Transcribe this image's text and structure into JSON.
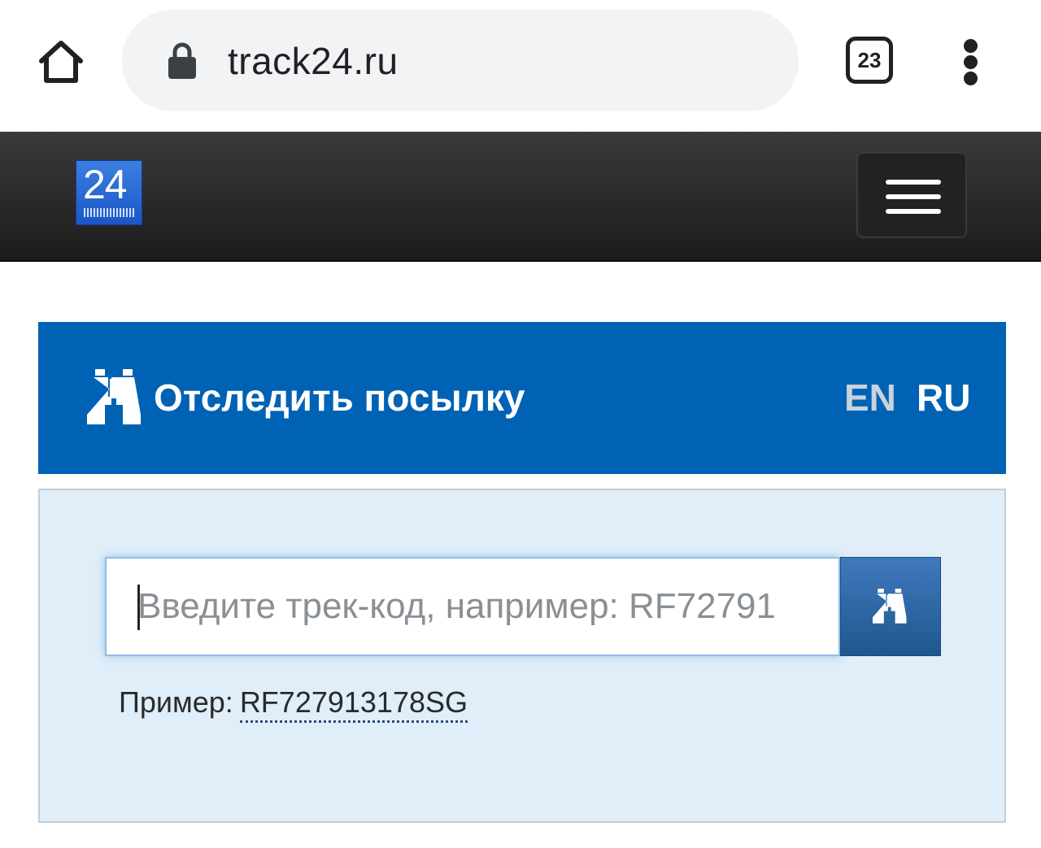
{
  "browser": {
    "url": "track24.ru",
    "tab_count": "23"
  },
  "header": {
    "logo_text": "24"
  },
  "tracker": {
    "title": "Отследить посылку",
    "lang_en": "EN",
    "lang_ru": "RU",
    "input_placeholder": "Введите трек-код, например: RF72791",
    "input_value": "",
    "example_label": "Пример:",
    "example_code": "RF727913178SG"
  },
  "colors": {
    "panel_blue": "#0062b4",
    "panel_body": "#dfeef8",
    "header_dark": "#2a2a2a",
    "button_blue": "#2d659f"
  },
  "icons": {
    "home": "home-icon",
    "lock": "lock-icon",
    "tabs": "tab-switcher-icon",
    "menu": "more-vert-icon",
    "hamburger": "hamburger-icon",
    "binoculars": "binoculars-icon"
  }
}
